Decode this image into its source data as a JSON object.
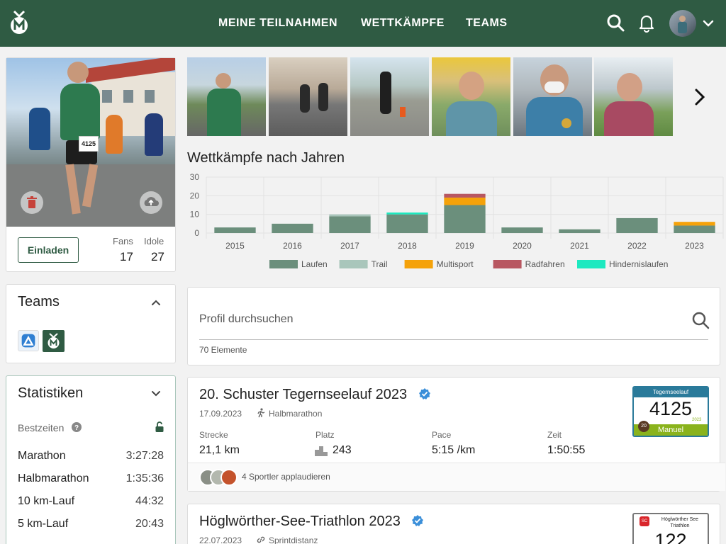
{
  "header": {
    "nav": [
      "MEINE TEILNAHMEN",
      "WETTKÄMPFE",
      "TEAMS"
    ]
  },
  "profile": {
    "bib_number": "4125",
    "invite_label": "Einladen",
    "fans_label": "Fans",
    "fans_value": "17",
    "idols_label": "Idole",
    "idols_value": "27"
  },
  "teams": {
    "title": "Teams"
  },
  "stats": {
    "title": "Statistiken",
    "best_label": "Bestzeiten",
    "rows": [
      {
        "name": "Marathon",
        "time": "3:27:28"
      },
      {
        "name": "Halbmarathon",
        "time": "1:35:36"
      },
      {
        "name": "10 km-Lauf",
        "time": "44:32"
      },
      {
        "name": "5 km-Lauf",
        "time": "20:43"
      }
    ]
  },
  "chart_title": "Wettkämpfe nach Jahren",
  "chart_data": {
    "type": "bar",
    "stacked": true,
    "categories": [
      "2015",
      "2016",
      "2017",
      "2018",
      "2019",
      "2020",
      "2021",
      "2022",
      "2023"
    ],
    "series": [
      {
        "name": "Laufen",
        "color": "#6b8f7c",
        "values": [
          3,
          5,
          9,
          10,
          15,
          3,
          2,
          8,
          4
        ]
      },
      {
        "name": "Trail",
        "color": "#a9c6bb",
        "values": [
          0,
          0,
          1,
          0,
          0,
          0,
          0,
          0,
          0
        ]
      },
      {
        "name": "Multisport",
        "color": "#f5a20a",
        "values": [
          0,
          0,
          0,
          0,
          4,
          0,
          0,
          0,
          2
        ]
      },
      {
        "name": "Radfahren",
        "color": "#b85761",
        "values": [
          0,
          0,
          0,
          0,
          2,
          0,
          0,
          0,
          0
        ]
      },
      {
        "name": "Hindernislaufen",
        "color": "#1de9c0",
        "values": [
          0,
          0,
          0,
          1,
          0,
          0,
          0,
          0,
          0
        ]
      }
    ],
    "yticks": [
      "0",
      "10",
      "20",
      "30"
    ],
    "ylim": [
      0,
      30
    ],
    "legend": "bottom"
  },
  "search": {
    "placeholder": "Profil durchsuchen",
    "count": "70 Elemente"
  },
  "race1": {
    "title": "20. Schuster Tegernseelauf 2023",
    "date": "17.09.2023",
    "type": "Halbmarathon",
    "labels": [
      "Strecke",
      "Platz",
      "Pace",
      "Zeit"
    ],
    "values": [
      "21,1 km",
      "243",
      "5:15 /km",
      "1:50:55"
    ],
    "applause": "4 Sportler applaudieren",
    "bib_event": "Tegernseelauf",
    "bib_number": "4125",
    "bib_year": "2023",
    "bib_badge": "20",
    "bib_name": "Manuel"
  },
  "race2": {
    "title": "Höglwörther-See-Triathlon 2023",
    "date": "22.07.2023",
    "type": "Sprintdistanz",
    "bib_badge": "SC",
    "bib_event": "Höglwörther See Triathlon",
    "bib_number": "122"
  },
  "colors": {
    "brand": "#2f5b43",
    "verified": "#3b8fd9",
    "bib_green": "#8ab31c",
    "bib_blue": "#2a7a9a"
  }
}
